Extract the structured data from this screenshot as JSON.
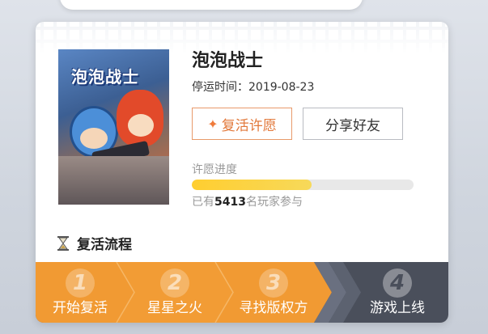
{
  "game": {
    "title": "泡泡战士",
    "cover_logo": "泡泡战士",
    "stop_date_label": "停运时间：",
    "stop_date": "2019-08-23"
  },
  "buttons": {
    "revive_icon": "✦",
    "revive_label": "复活许愿",
    "share_label": "分享好友"
  },
  "progress": {
    "label": "许愿进度",
    "fraction": 0.54,
    "participants_prefix": "已有",
    "participants_count": "5413",
    "participants_suffix": "名玩家参与"
  },
  "flow": {
    "title": "复活流程",
    "steps": [
      {
        "num": "1",
        "label": "开始复活",
        "state": "done"
      },
      {
        "num": "2",
        "label": "星星之火",
        "state": "done"
      },
      {
        "num": "3",
        "label": "寻找版权方",
        "state": "done"
      },
      {
        "num": "4",
        "label": "游戏上线",
        "state": "pending"
      }
    ]
  },
  "colors": {
    "accent_orange": "#e2783a",
    "step_active": "#f19a33",
    "step_inactive": "#4a4f5b",
    "progress_fill": "#ffce30"
  }
}
